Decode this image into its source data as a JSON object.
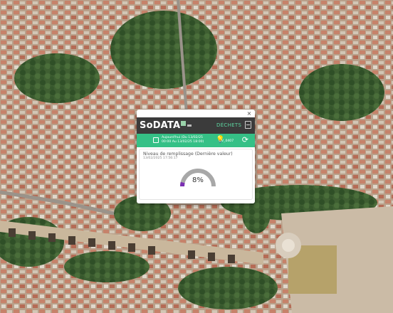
{
  "popup": {
    "close_label": "×",
    "logo_text": "SoDATA",
    "header_tab": "DÉCHETS",
    "period": {
      "line1": "Aujourd'hui (Du 13/02/25",
      "line2": "00:00 Au 13/02/25 18:00)"
    },
    "device_id": "V_0407",
    "card": {
      "title": "Niveau de remplissage (Dernière valeur)",
      "date": "13/02/2025 17:56:17",
      "fill_percent": 8,
      "fill_label": "8%",
      "gauge_color": "#7b2fb3",
      "gauge_track_color": "#a8a8a8"
    }
  },
  "colors": {
    "header_bg": "#3b3b3b",
    "accent_green": "#35c086",
    "tab_green": "#5dd6a0"
  },
  "icons": {
    "calendar": "calendar-icon",
    "bulb": "lightbulb-icon",
    "refresh": "refresh-icon",
    "document": "document-icon",
    "close": "close-icon"
  }
}
